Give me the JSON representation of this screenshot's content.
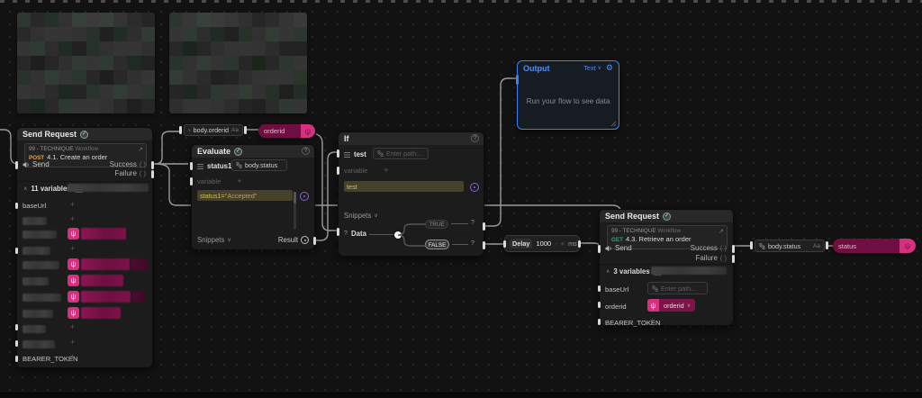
{
  "colors": {
    "accent_pink": "#d6307f",
    "accent_blue": "#4f8ff7",
    "post_orange": "#e8a33d",
    "get_green": "#2ea36b",
    "code_yellow": "#d2c05a",
    "wire_gray": "#9a9a9a"
  },
  "nodes": {
    "sr1": {
      "title": "Send Request",
      "collection": "99 - TECHNIQUE",
      "collection_suffix": "Workflow",
      "method": "POST",
      "request_name": "4.1. Create an order",
      "send_label": "Send",
      "success_label": "Success",
      "failure_label": "Failure",
      "parens": "( )",
      "variables_count": "11 variables",
      "var_first": "baseUrl",
      "var_last": "BEARER_TOKEN",
      "plus": "+",
      "collapse_chevron": "∧"
    },
    "eval": {
      "title": "Evaluate",
      "field_label": "status1",
      "path_value": "body.status",
      "variable_label": "variable",
      "plus": "+",
      "code_lhs": "status1=",
      "code_rhs": "\"Accepted\"",
      "snippets_label": "Snippets",
      "snippets_chevron": "∨",
      "result_label": "Result",
      "help": "?"
    },
    "if": {
      "title": "If",
      "field_label": "test",
      "path_placeholder": "Enter path...",
      "variable_label": "variable",
      "plus": "+",
      "code": "test",
      "snippets_label": "Snippets",
      "snippets_chevron": "∨",
      "data_label": "Data",
      "true_label": "TRUE",
      "false_label": "FALSE",
      "q_mark": "?",
      "help": "?"
    },
    "output": {
      "title": "Output",
      "mode": "Text",
      "mode_chevron": "∨",
      "empty_text": "Run your flow to see data"
    },
    "delay": {
      "label": "Delay",
      "value": "1000",
      "minus": "-",
      "plus": "+",
      "unit": "ms"
    },
    "sr2": {
      "title": "Send Request",
      "collection": "99 - TECHNIQUE",
      "collection_suffix": "Workflow",
      "method": "GET",
      "request_name": "4.3. Retrieve an order",
      "send_label": "Send",
      "success_label": "Success",
      "failure_label": "Failure",
      "parens": "( )",
      "variables_count": "3 variables",
      "var_baseurl": "baseUrl",
      "var_orderid": "orderid",
      "var_token": "BEARER_TOKEN",
      "path_placeholder": "Enter path...",
      "orderid_chip": "orderid",
      "orderid_chip_chevron": "∨",
      "plus": "+",
      "collapse_chevron": "∧"
    }
  },
  "chips": {
    "body_orderid": "body.orderid",
    "body_status": "body.status",
    "aa": "Aa"
  },
  "tags": {
    "orderid": "orderid",
    "status": "status"
  }
}
